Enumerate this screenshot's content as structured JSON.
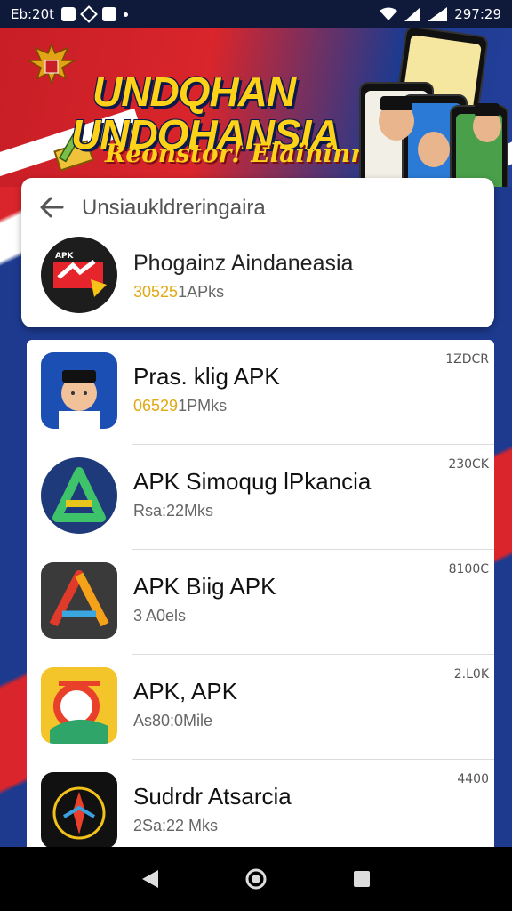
{
  "status_bar": {
    "time_left": "Eb:20t",
    "time_right": "297:29"
  },
  "banner": {
    "headline_line1": "UNDQHAN",
    "headline_line2": "UNDOHANSIA",
    "subheadline": "Reonstor! Elaininniomu!",
    "colors": {
      "red": "#d9252b",
      "blue": "#1d3a8f",
      "yellow": "#ffd21a"
    }
  },
  "header": {
    "back_icon": "arrow-left",
    "title": "Unsiaukldreringaira"
  },
  "featured": {
    "name": "Phogainz Aindaneasia",
    "sub_highlight": "30525",
    "sub_rest": "1APks"
  },
  "list": [
    {
      "name": "Pras. klig APK",
      "sub_highlight": "06529",
      "sub_rest": "1PMks",
      "size": "1ZDCR",
      "icon": "person-with-hat"
    },
    {
      "name": "APK Simoqug lPkancia",
      "sub_highlight": "",
      "sub_rest": "Rsa:22Mks",
      "size": "230CK",
      "icon": "letter-a-circle"
    },
    {
      "name": "APK Biig APK",
      "sub_highlight": "",
      "sub_rest": "3 A0els",
      "size": "8100C",
      "icon": "letter-a-triangle"
    },
    {
      "name": "APK, APK",
      "sub_highlight": "",
      "sub_rest": "As80:0Mile",
      "size": "2.L0K",
      "icon": "orange-badge"
    },
    {
      "name": "Sudrdr Atsarcia",
      "sub_highlight": "",
      "sub_rest": "2Sa:22 Mks",
      "size": "4400",
      "icon": "garuda-emblem"
    }
  ],
  "nav": {
    "back": "triangle-back",
    "home": "circle-home",
    "recents": "square-recents"
  }
}
